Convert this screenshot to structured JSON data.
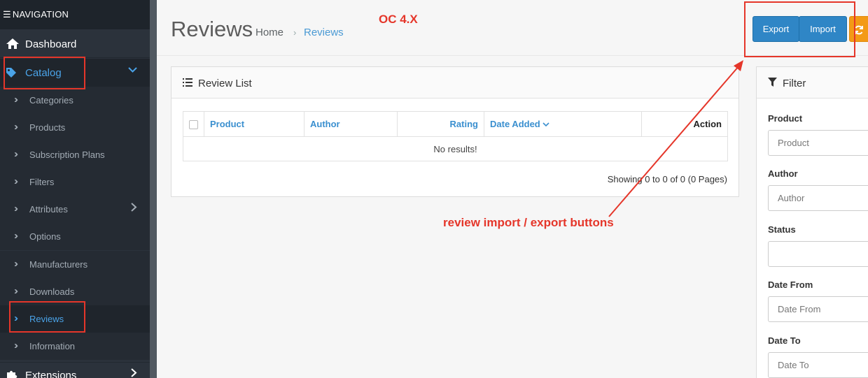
{
  "sidebar": {
    "header": "NAVIGATION",
    "dashboard": "Dashboard",
    "catalog": "Catalog",
    "items": [
      "Categories",
      "Products",
      "Subscription Plans",
      "Filters",
      "Attributes",
      "Options",
      "Manufacturers",
      "Downloads",
      "Reviews",
      "Information"
    ],
    "extensions": "Extensions"
  },
  "header": {
    "title": "Reviews",
    "breadcrumb_home": "Home",
    "breadcrumb_current": "Reviews",
    "export_label": "Export",
    "import_label": "Import"
  },
  "review_list": {
    "title": "Review List",
    "columns": [
      "Product",
      "Author",
      "Rating",
      "Date Added",
      "Action"
    ],
    "empty": "No results!",
    "showing": "Showing 0 to 0 of 0 (0 Pages)"
  },
  "filter": {
    "title": "Filter",
    "product_label": "Product",
    "product_placeholder": "Product",
    "author_label": "Author",
    "author_placeholder": "Author",
    "status_label": "Status",
    "date_from_label": "Date From",
    "date_from_placeholder": "Date From",
    "date_to_label": "Date To",
    "date_to_placeholder": "Date To"
  },
  "annotations": {
    "version": "OC 4.X",
    "note": "review import / export buttons"
  },
  "colors": {
    "accent": "#2f86c6",
    "annotation": "#e5362a",
    "sidebar": "#2b323b"
  }
}
